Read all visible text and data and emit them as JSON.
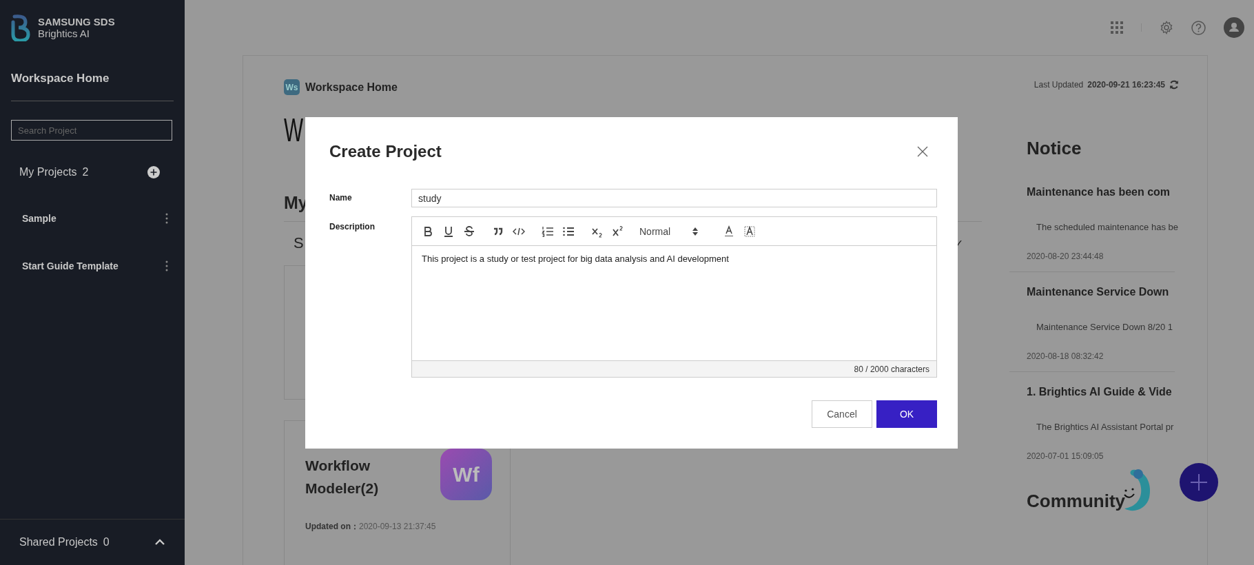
{
  "sidebar": {
    "logo": {
      "line_1": "SAMSUNG SDS",
      "line_2": "Brightics AI"
    },
    "title": "Workspace Home",
    "search": {
      "placeholder": "Search Project"
    },
    "my_projects": {
      "label": "My Projects",
      "count": "2"
    },
    "projects": [
      {
        "name": "Sample"
      },
      {
        "name": "Start Guide Template"
      }
    ],
    "shared_projects": {
      "label": "Shared Projects",
      "count": "0"
    }
  },
  "workspace": {
    "badge": "Ws",
    "title": "Workspace Home",
    "heading": "W",
    "section": "My",
    "tab": "S",
    "check": "✓",
    "cards": [
      {
        "kind": "covered"
      },
      {
        "kind": "app",
        "title": "Workflow Modeler(2)",
        "badge": "Wf",
        "updated_label": "Updated on：",
        "updated": "2020-09-13 21:37:45"
      }
    ]
  },
  "last_updated": {
    "label": "Last Updated",
    "value": "2020-09-21 16:23:45"
  },
  "notice": {
    "title": "Notice",
    "items": [
      {
        "title": "Maintenance has been com",
        "summary": "The scheduled maintenance has be",
        "date": "2020-08-20 23:44:48"
      },
      {
        "title": "Maintenance Service Down",
        "summary": "Maintenance Service Down 8/20 1",
        "date": "2020-08-18 08:32:42"
      },
      {
        "title": "1. Brightics AI Guide & Vide",
        "summary": "The Brightics AI Assistant Portal pr",
        "date": "2020-07-01 15:09:05"
      }
    ]
  },
  "community": {
    "title": "Community"
  },
  "dialog": {
    "title": "Create Project",
    "name": {
      "label": "Name",
      "value": "study"
    },
    "description": {
      "label": "Description",
      "text": "This project is a study or test project for big data analysis and AI development",
      "style": "Normal",
      "counter": "80 / 2000 characters"
    },
    "buttons": [
      {
        "label": "Cancel",
        "kind": "secondary"
      },
      {
        "label": "OK",
        "kind": "primary"
      }
    ]
  }
}
